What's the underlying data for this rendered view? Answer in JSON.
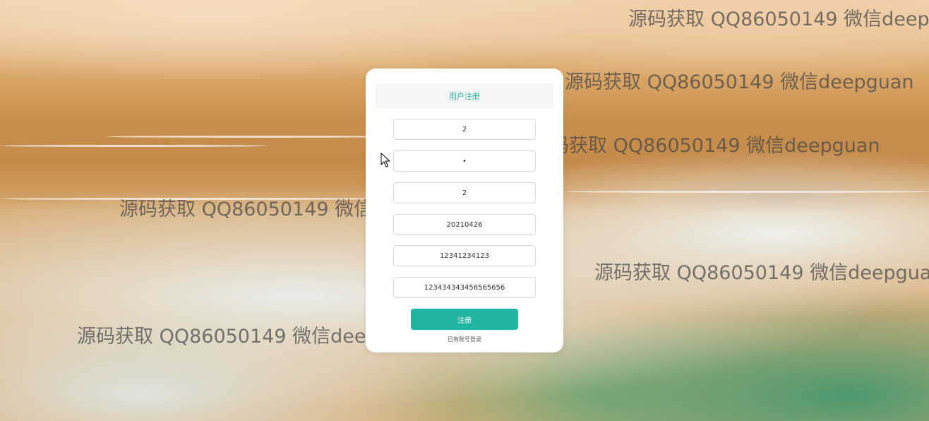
{
  "form": {
    "title": "用户注册",
    "fields": [
      {
        "name": "username",
        "value": "2",
        "type": "text"
      },
      {
        "name": "password",
        "value": "•",
        "type": "password"
      },
      {
        "name": "name",
        "value": "2",
        "type": "text"
      },
      {
        "name": "birthday",
        "value": "20210426",
        "type": "text"
      },
      {
        "name": "phone",
        "value": "12341234123",
        "type": "text"
      },
      {
        "name": "id-number",
        "value": "123434343456565656",
        "type": "text"
      }
    ],
    "submit_label": "注册",
    "login_link": "已有账号登录"
  },
  "watermark": {
    "text": "源码获取 QQ86050149 微信deepguan"
  },
  "colors": {
    "accent": "#1fb5a0",
    "title": "#20b39a"
  },
  "icons": {
    "cursor": "mouse-pointer-icon"
  }
}
